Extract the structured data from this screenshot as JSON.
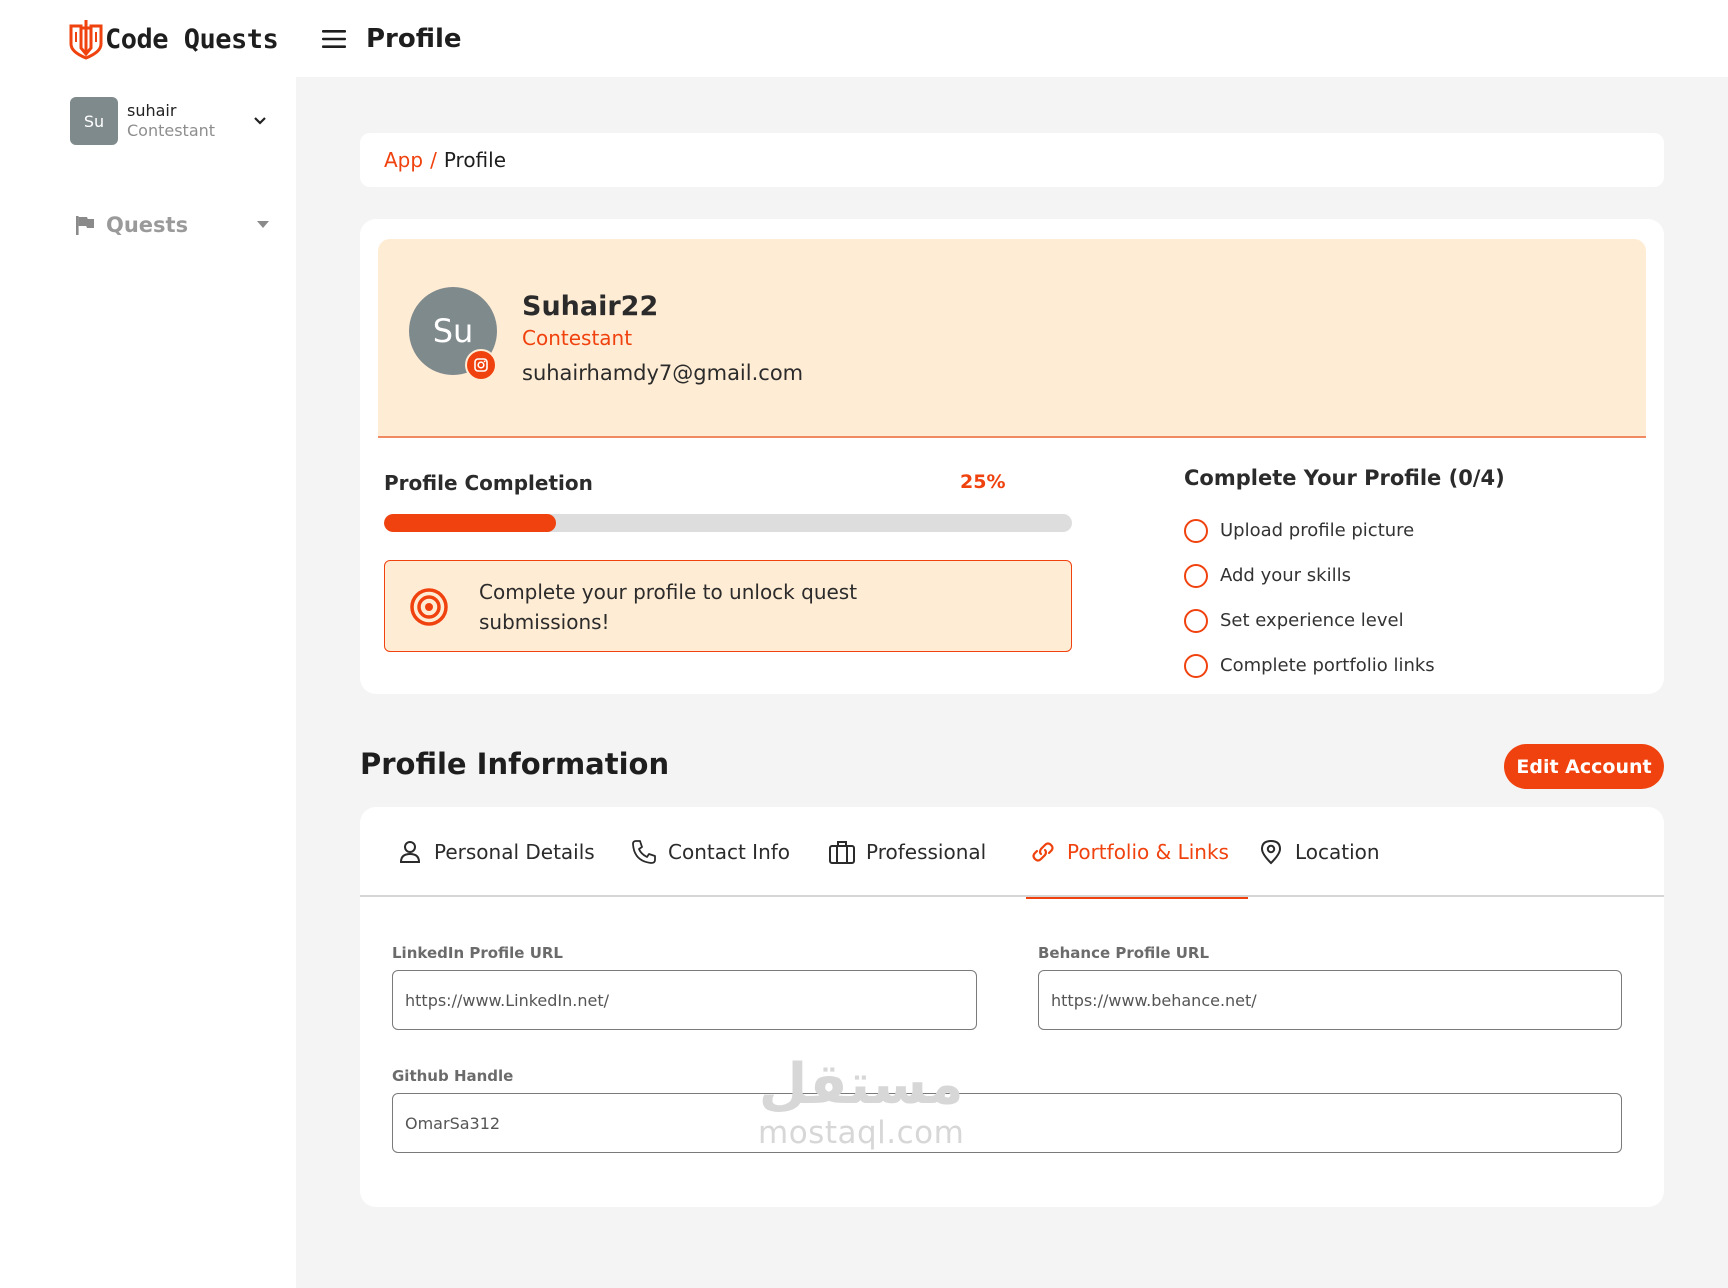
{
  "brand": {
    "name": "Code Quests",
    "logo_icon": "shield-sword-logo",
    "accent": "#f0420e"
  },
  "sidebar": {
    "user": {
      "avatar_initials": "Su",
      "name": "suhair",
      "role": "Contestant"
    },
    "items": [
      {
        "label": "Quests",
        "icon": "flag-icon"
      }
    ]
  },
  "header": {
    "title": "Profile",
    "menu_icon": "hamburger-menu-icon"
  },
  "breadcrumb": {
    "app": "App",
    "separator": "/",
    "current": "Profile"
  },
  "profile": {
    "avatar_initials": "Su",
    "username": "Suhair22",
    "role": "Contestant",
    "email": "suhairhamdy7@gmail.com"
  },
  "completion": {
    "label": "Profile Completion",
    "percent_text": "25%",
    "progress": 0.25,
    "notice": "Complete your profile to unlock quest submissions!"
  },
  "checklist": {
    "title": "Complete Your Profile (0/4)",
    "items": [
      {
        "label": "Upload profile picture",
        "done": false
      },
      {
        "label": "Add your skills",
        "done": false
      },
      {
        "label": "Set experience level",
        "done": false
      },
      {
        "label": "Complete portfolio links",
        "done": false
      }
    ]
  },
  "profile_info": {
    "title": "Profile Information",
    "edit_label": "Edit Account",
    "tabs": [
      {
        "label": "Personal Details",
        "icon": "person-icon"
      },
      {
        "label": "Contact Info",
        "icon": "phone-icon"
      },
      {
        "label": "Professional",
        "icon": "briefcase-icon"
      },
      {
        "label": "Portfolio & Links",
        "icon": "link-icon",
        "active": true
      },
      {
        "label": "Location",
        "icon": "map-pin-icon"
      }
    ],
    "fields": {
      "linkedin": {
        "label": "LinkedIn Profile URL",
        "value": "https://www.LinkedIn.net/"
      },
      "behance": {
        "label": "Behance Profile URL",
        "value": "https://www.behance.net/"
      },
      "github": {
        "label": "Github Handle",
        "value": "OmarSa312"
      }
    }
  },
  "watermark": {
    "arabic": "مستقل",
    "latin": "mostaql.com"
  }
}
